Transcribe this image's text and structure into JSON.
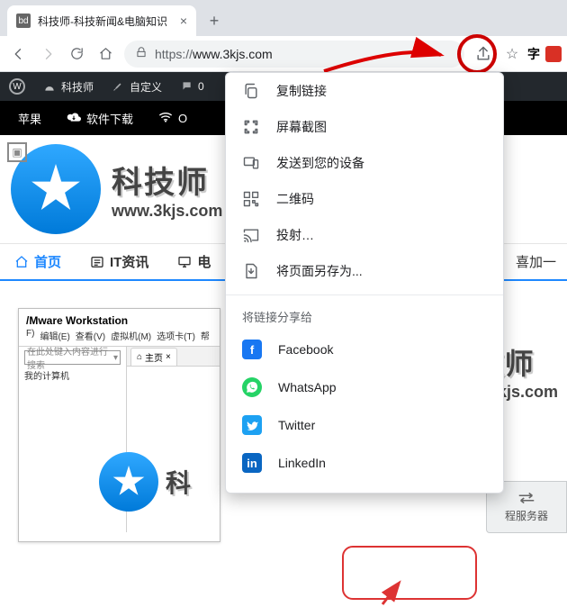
{
  "tab": {
    "favicon_text": "bd",
    "title": "科技师-科技新闻&电脑知识"
  },
  "toolbar": {
    "url_scheme": "https://",
    "url_host": "www.3kjs.com",
    "font_label": "字"
  },
  "wpbar": {
    "site": "科技师",
    "customize": "自定义",
    "comments": "0"
  },
  "subbar": {
    "apple": "苹果",
    "download": "软件下载",
    "wifi_prefix": "O"
  },
  "header": {
    "brand_zh": "科技师",
    "brand_en": "www.3kjs.com"
  },
  "mainnav": {
    "home": "首页",
    "it": "IT资讯",
    "pc": "电",
    "tail": "喜加一"
  },
  "vm": {
    "title": "/Mware Workstation",
    "menu": [
      "F)",
      "编辑(E)",
      "查看(V)",
      "虚拟机(M)",
      "选项卡(T)",
      "帮"
    ],
    "search_placeholder": "在此处键入内容进行搜索",
    "tree_item": "我的计算机",
    "tab_label": "主页"
  },
  "share_menu": {
    "items": [
      {
        "label": "复制链接",
        "icon": "copy"
      },
      {
        "label": "屏幕截图",
        "icon": "crop"
      },
      {
        "label": "发送到您的设备",
        "icon": "devices"
      },
      {
        "label": "二维码",
        "icon": "qr"
      },
      {
        "label": "投射…",
        "icon": "cast"
      },
      {
        "label": "将页面另存为...",
        "icon": "save"
      }
    ],
    "section": "将链接分享给",
    "socials": [
      {
        "label": "Facebook",
        "class": "fb",
        "glyph": "f"
      },
      {
        "label": "WhatsApp",
        "class": "wa",
        "glyph": "✆"
      },
      {
        "label": "Twitter",
        "class": "tw",
        "glyph": "t"
      },
      {
        "label": "LinkedIn",
        "class": "li",
        "glyph": "in"
      }
    ]
  },
  "server_btn": {
    "label": "程服务器"
  },
  "right_brand": {
    "zh": "科技师",
    "en": "www.3kjs.com"
  },
  "wm_brand": {
    "zh": "科"
  }
}
